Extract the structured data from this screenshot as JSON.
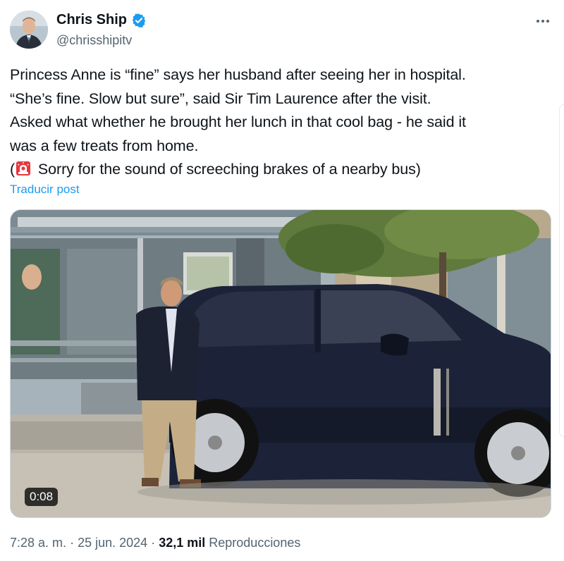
{
  "author": {
    "display_name": "Chris Ship",
    "handle": "@chrisshipitv",
    "verified": true
  },
  "tweet": {
    "lines": [
      "Princess Anne is “fine” says her husband after seeing her in hospital.",
      "“She’s fine. Slow but sure”, said Sir Tim Laurence after the visit.",
      "Asked what whether he brought her lunch in that cool bag - he said it",
      "was a few treats from home."
    ],
    "last_line_open": "(",
    "last_line_rest": " Sorry for the sound of screeching brakes of a nearby bus)",
    "emoji_icon": "police-car-light-icon",
    "translate_label": "Traducir post"
  },
  "media": {
    "duration": "0:08"
  },
  "meta": {
    "time": "7:28 a. m.",
    "separator": "·",
    "date": "25 jun. 2024",
    "views_count": "32,1 mil",
    "views_label": "Reproducciones"
  },
  "colors": {
    "link": "#1d9bf0",
    "secondary_text": "#536471",
    "primary_text": "#0f1419",
    "verified_badge": "#1d9bf0"
  }
}
